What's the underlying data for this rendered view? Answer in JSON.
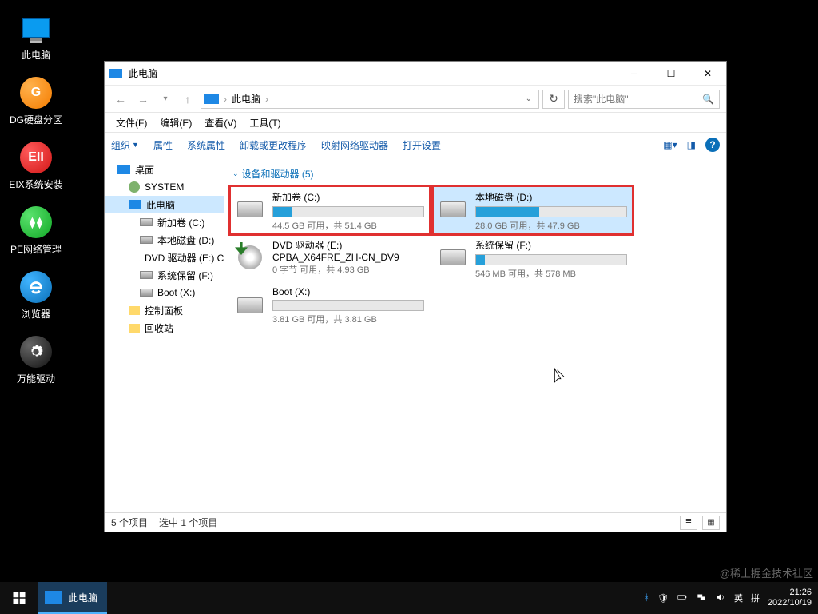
{
  "desktop": {
    "icons": [
      {
        "name": "this-pc",
        "label": "此电脑"
      },
      {
        "name": "dg-partition",
        "label": "DG硬盘分区"
      },
      {
        "name": "eix-install",
        "label": "EIX系统安装"
      },
      {
        "name": "pe-net",
        "label": "PE网络管理"
      },
      {
        "name": "browser",
        "label": "浏览器"
      },
      {
        "name": "driver",
        "label": "万能驱动"
      }
    ]
  },
  "window": {
    "title": "此电脑",
    "breadcrumb": "此电脑",
    "search_placeholder": "搜索\"此电脑\"",
    "menus": [
      "文件(F)",
      "编辑(E)",
      "查看(V)",
      "工具(T)"
    ],
    "toolbar": {
      "organize": "组织",
      "items": [
        "属性",
        "系统属性",
        "卸载或更改程序",
        "映射网络驱动器",
        "打开设置"
      ]
    },
    "tree": [
      {
        "label": "桌面",
        "depth": 0,
        "icon": "monitor"
      },
      {
        "label": "SYSTEM",
        "depth": 1,
        "icon": "user"
      },
      {
        "label": "此电脑",
        "depth": 1,
        "icon": "monitor",
        "selected": true
      },
      {
        "label": "新加卷 (C:)",
        "depth": 2,
        "icon": "drive"
      },
      {
        "label": "本地磁盘 (D:)",
        "depth": 2,
        "icon": "drive"
      },
      {
        "label": "DVD 驱动器 (E:) C",
        "depth": 2,
        "icon": "dvd"
      },
      {
        "label": "系统保留 (F:)",
        "depth": 2,
        "icon": "drive"
      },
      {
        "label": "Boot (X:)",
        "depth": 2,
        "icon": "drive"
      },
      {
        "label": "控制面板",
        "depth": 1,
        "icon": "folder"
      },
      {
        "label": "回收站",
        "depth": 1,
        "icon": "folder"
      }
    ],
    "group_header": "设备和驱动器 (5)",
    "drives": [
      {
        "name": "新加卷 (C:)",
        "stat": "44.5 GB 可用，共 51.4 GB",
        "fill": 13,
        "icon": "hdd",
        "highlight": true
      },
      {
        "name": "本地磁盘 (D:)",
        "stat": "28.0 GB 可用，共 47.9 GB",
        "fill": 42,
        "icon": "hdd",
        "highlight": true,
        "selected": true
      },
      {
        "name": "DVD 驱动器 (E:)",
        "sub": "CPBA_X64FRE_ZH-CN_DV9",
        "stat": "0 字节 可用，共 4.93 GB",
        "icon": "dvd"
      },
      {
        "name": "系统保留 (F:)",
        "stat": "546 MB 可用，共 578 MB",
        "fill": 6,
        "icon": "hdd"
      },
      {
        "name": "Boot (X:)",
        "stat": "3.81 GB 可用，共 3.81 GB",
        "fill": 0,
        "icon": "hdd"
      }
    ],
    "status": {
      "count": "5 个项目",
      "selection": "选中 1 个项目"
    }
  },
  "taskbar": {
    "app": "此电脑",
    "ime1": "英",
    "ime2": "拼",
    "time": "21:26",
    "date": "2022/10/19"
  },
  "watermark": "@稀土掘金技术社区"
}
